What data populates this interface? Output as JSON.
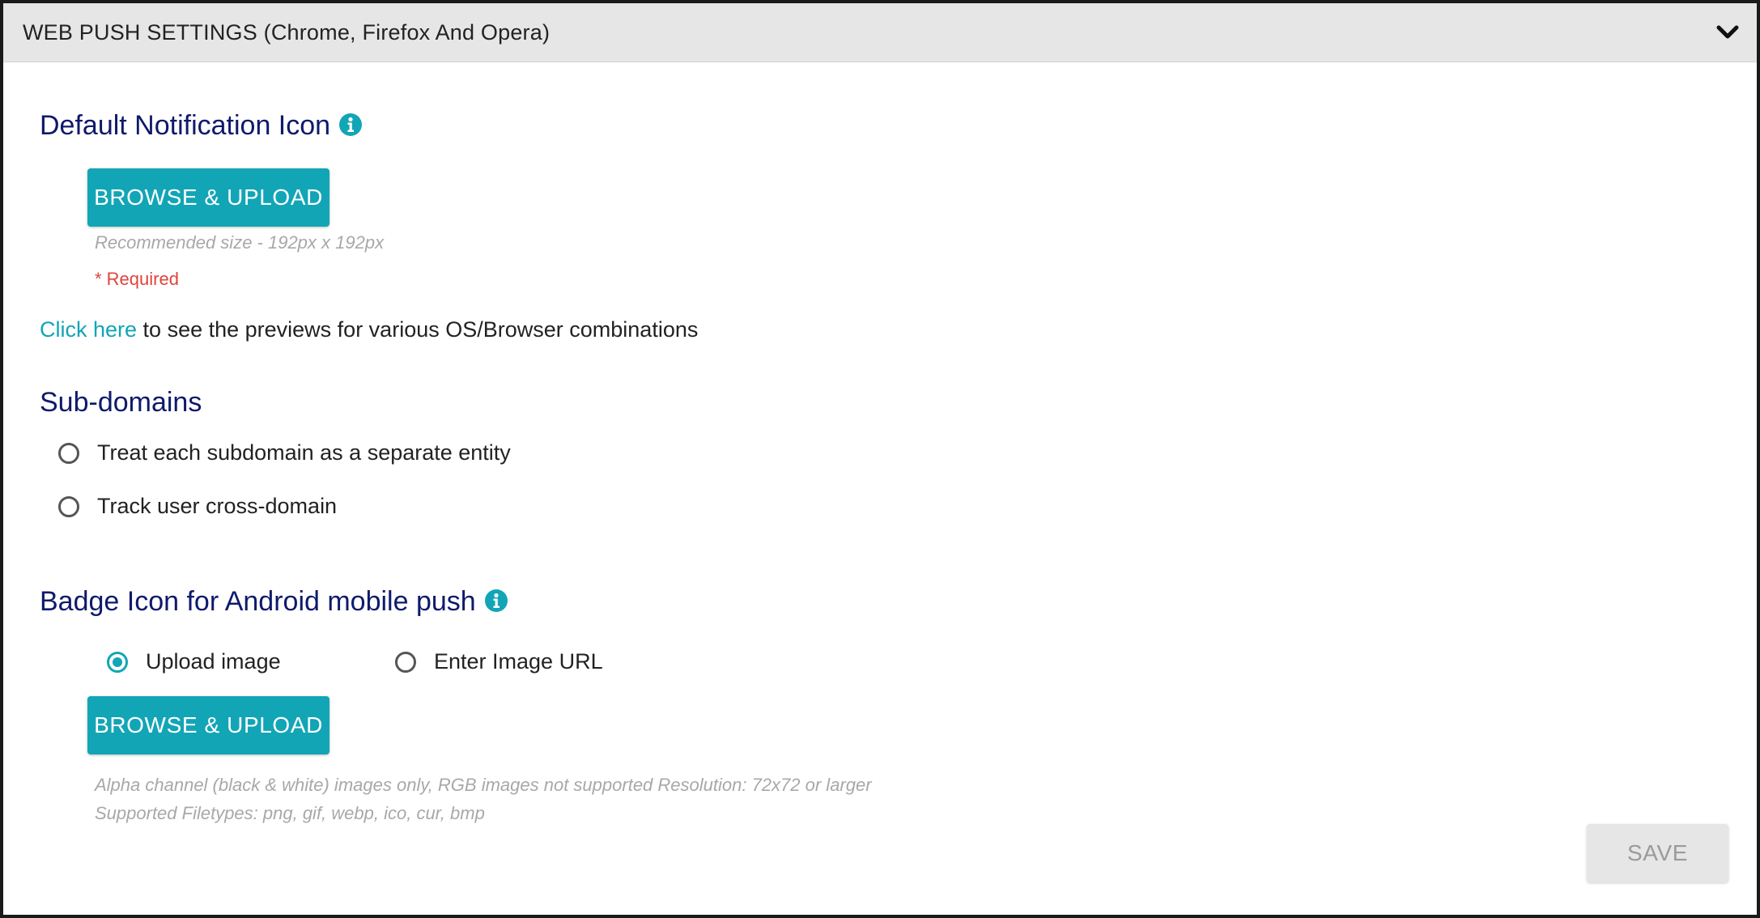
{
  "header": {
    "title": "WEB PUSH SETTINGS (Chrome, Firefox And Opera)",
    "toggle_icon": "chevron-down-icon"
  },
  "notification_icon": {
    "title": "Default Notification Icon",
    "info_icon": "info-icon",
    "upload_label": "BROWSE & UPLOAD",
    "size_hint": "Recommended size - 192px x 192px",
    "required_text": "* Required"
  },
  "preview": {
    "link_text": "Click here",
    "rest_text": " to see the previews for various OS/Browser combinations"
  },
  "subdomains": {
    "title": "Sub-domains",
    "options": [
      {
        "label": "Treat each subdomain as a separate entity",
        "selected": false
      },
      {
        "label": "Track user cross-domain",
        "selected": false
      }
    ]
  },
  "badge_icon": {
    "title": "Badge Icon for Android mobile push",
    "info_icon": "info-icon",
    "options": [
      {
        "label": "Upload image",
        "selected": true
      },
      {
        "label": "Enter Image URL",
        "selected": false
      }
    ],
    "upload_label": "BROWSE & UPLOAD",
    "hint_line1": "Alpha channel (black & white) images only, RGB images not supported Resolution: 72x72 or larger",
    "hint_line2": "Supported Filetypes: png, gif, webp, ico, cur, bmp"
  },
  "actions": {
    "save_label": "SAVE",
    "save_enabled": false
  },
  "colors": {
    "accent": "#12a5b6",
    "heading": "#0e1a6b",
    "required": "#e0433b",
    "header_bg": "#e6e6e6"
  }
}
